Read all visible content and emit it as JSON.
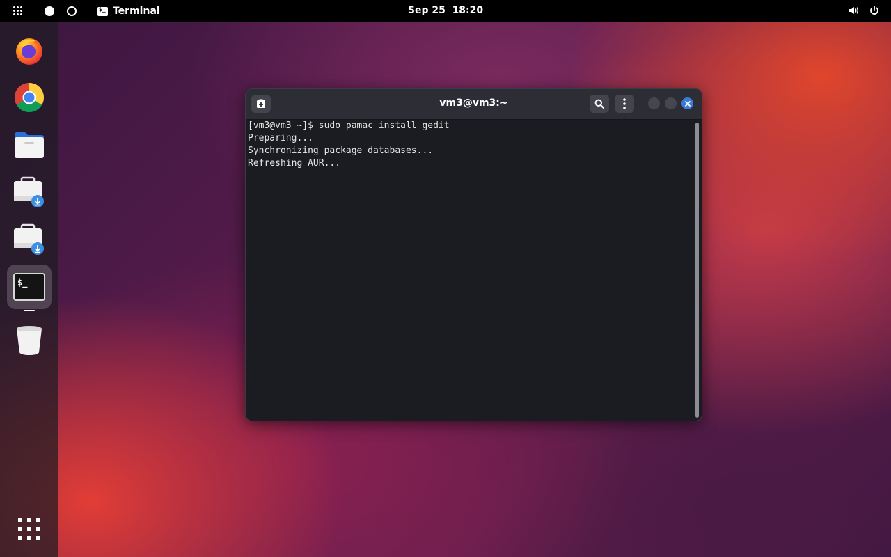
{
  "topbar": {
    "app_name": "Terminal",
    "clock": "Sep 25  18:20",
    "icons": [
      "activities-icon",
      "workspace-dot-icon",
      "terminal-icon",
      "volume-icon",
      "power-icon"
    ]
  },
  "dock": {
    "items": [
      {
        "name": "firefox",
        "icon": "firefox-icon"
      },
      {
        "name": "chrome",
        "icon": "chrome-icon"
      },
      {
        "name": "files",
        "icon": "folder-icon"
      },
      {
        "name": "installer-1",
        "icon": "software-download-icon"
      },
      {
        "name": "installer-2",
        "icon": "software-download-icon"
      },
      {
        "name": "terminal",
        "icon": "terminal-icon",
        "active": true
      },
      {
        "name": "trash",
        "icon": "trash-icon"
      }
    ],
    "apps_grid_icon": "show-apps-icon"
  },
  "terminal": {
    "title": "vm3@vm3:~",
    "lines": [
      "[vm3@vm3 ~]$ sudo pamac install gedit",
      "Preparing...",
      "Synchronizing package databases...",
      "Refreshing AUR..."
    ]
  },
  "colors": {
    "accent": "#3a7bd5",
    "terminal_bg": "#1b1c22",
    "header_bg": "#2d2e35"
  }
}
